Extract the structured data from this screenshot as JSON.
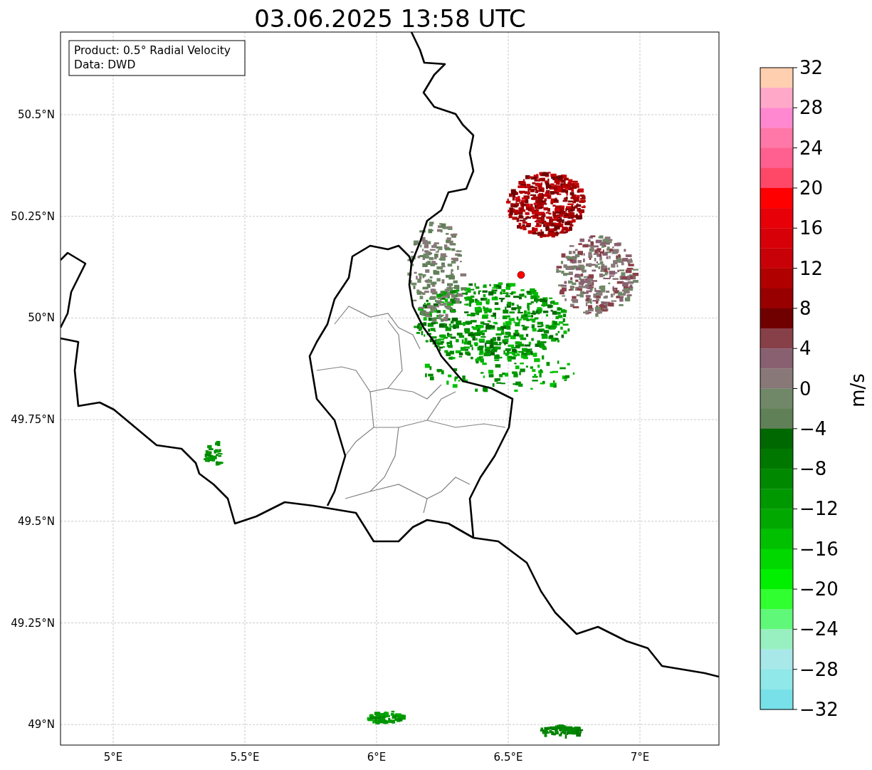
{
  "title": "03.06.2025 13:58 UTC",
  "info_box": {
    "lines": [
      "Product: 0.5° Radial Velocity",
      "Data: DWD"
    ]
  },
  "map": {
    "y_tick_labels": [
      "50.5°N",
      "50.25°N",
      "50°N",
      "49.75°N",
      "49.5°N",
      "49.25°N",
      "49°N"
    ],
    "x_tick_labels": [
      "5°E",
      "5.5°E",
      "6°E",
      "6.5°E",
      "7°E"
    ]
  },
  "colorbar": {
    "label": "m/s",
    "tick_labels": [
      "32",
      "28",
      "24",
      "20",
      "16",
      "12",
      "8",
      "4",
      "0",
      "−4",
      "−8",
      "−12",
      "−16",
      "−20",
      "−24",
      "−28",
      "−32"
    ],
    "segments": [
      {
        "color": "#ffcfb0"
      },
      {
        "color": "#ffa8c8"
      },
      {
        "color": "#ff88d0"
      },
      {
        "color": "#ff78a8"
      },
      {
        "color": "#ff6090"
      },
      {
        "color": "#ff4868"
      },
      {
        "color": "#ff0000"
      },
      {
        "color": "#e80008"
      },
      {
        "color": "#d80008"
      },
      {
        "color": "#c80008"
      },
      {
        "color": "#b00000"
      },
      {
        "color": "#980000"
      },
      {
        "color": "#700000"
      },
      {
        "color": "#884048"
      },
      {
        "color": "#886070"
      },
      {
        "color": "#887878"
      },
      {
        "color": "#708868"
      },
      {
        "color": "#608058"
      },
      {
        "color": "#006800"
      },
      {
        "color": "#007800"
      },
      {
        "color": "#008800"
      },
      {
        "color": "#009800"
      },
      {
        "color": "#00a800"
      },
      {
        "color": "#00c000"
      },
      {
        "color": "#00d800"
      },
      {
        "color": "#00f000"
      },
      {
        "color": "#30ff30"
      },
      {
        "color": "#60f878"
      },
      {
        "color": "#98f0c0"
      },
      {
        "color": "#a8e8e8"
      },
      {
        "color": "#90e8e8"
      },
      {
        "color": "#78e0e8"
      }
    ]
  }
}
